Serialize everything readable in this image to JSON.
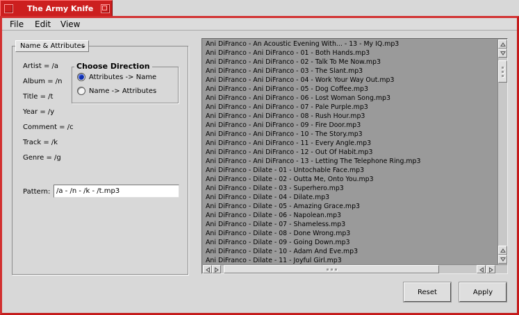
{
  "window": {
    "title": "The Army Knife"
  },
  "menu": {
    "file": "File",
    "edit": "Edit",
    "view": "View"
  },
  "left_panel": {
    "mode_menu": "Name & Attributes",
    "attributes": [
      "Artist = /a",
      "Album = /n",
      "Title = /t",
      "Year = /y",
      "Comment = /c",
      "Track = /k",
      "Genre = /g"
    ],
    "direction": {
      "title": "Choose Direction",
      "options": [
        {
          "label": "Attributes -> Name",
          "selected": true
        },
        {
          "label": "Name -> Attributes",
          "selected": false
        }
      ]
    },
    "pattern": {
      "label": "Pattern:",
      "value": "/a - /n - /k - /t.mp3"
    }
  },
  "file_list": {
    "items": [
      "Ani DiFranco - An Acoustic Evening With... - 13 - My IQ.mp3",
      "Ani DiFranco - Ani DiFranco - 01 - Both Hands.mp3",
      "Ani DiFranco - Ani DiFranco - 02 - Talk To Me Now.mp3",
      "Ani DiFranco - Ani DiFranco - 03 - The Slant.mp3",
      "Ani DiFranco - Ani DiFranco - 04 - Work Your Way Out.mp3",
      "Ani DiFranco - Ani DiFranco - 05 - Dog Coffee.mp3",
      "Ani DiFranco - Ani DiFranco - 06 - Lost Woman Song.mp3",
      "Ani DiFranco - Ani DiFranco - 07 - Pale Purple.mp3",
      "Ani DiFranco - Ani DiFranco - 08 - Rush Hour.mp3",
      "Ani DiFranco - Ani DiFranco - 09 - Fire Door.mp3",
      "Ani DiFranco - Ani DiFranco - 10 - The Story.mp3",
      "Ani DiFranco - Ani DiFranco - 11 - Every Angle.mp3",
      "Ani DiFranco - Ani DiFranco - 12 - Out Of Habit.mp3",
      "Ani DiFranco - Ani DiFranco - 13 - Letting The Telephone Ring.mp3",
      "Ani DiFranco - Dilate - 01 - Untochable Face.mp3",
      "Ani DiFranco - Dilate - 02 - Outta Me, Onto You.mp3",
      "Ani DiFranco - Dilate - 03 - Superhero.mp3",
      "Ani DiFranco - Dilate - 04 - Dilate.mp3",
      "Ani DiFranco - Dilate - 05 - Amazing Grace.mp3",
      "Ani DiFranco - Dilate - 06 - Napolean.mp3",
      "Ani DiFranco - Dilate - 07 - Shameless.mp3",
      "Ani DiFranco - Dilate - 08 - Done Wrong.mp3",
      "Ani DiFranco - Dilate - 09 - Going Down.mp3",
      "Ani DiFranco - Dilate - 10 - Adam And Eve.mp3",
      "Ani DiFranco - Dilate - 11 - Joyful Girl.mp3"
    ]
  },
  "buttons": {
    "reset": "Reset",
    "apply": "Apply"
  },
  "colors": {
    "title_bar": "#cc1f1f",
    "window_background": "#d8d8d8",
    "list_background": "#9a9a9a",
    "radio_selected": "#1030b0"
  }
}
